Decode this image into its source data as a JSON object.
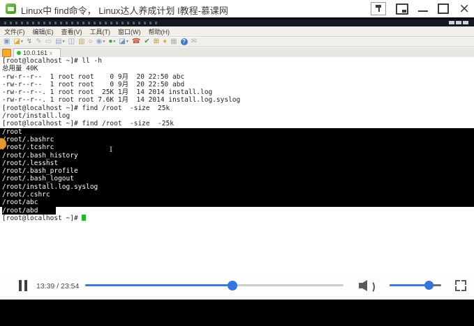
{
  "window": {
    "title": "Linux中 find命令， Linux达人养成计划 I教程-慕课网"
  },
  "crt": {
    "menu": [
      "文件(F)",
      "编辑(E)",
      "查看(V)",
      "工具(T)",
      "窗口(W)",
      "帮助(H)"
    ],
    "tab": {
      "label": "10.0.161",
      "status_color": "#2fbf2f",
      "close_glyph": "x"
    },
    "toolbar_icons": [
      {
        "name": "new-session-icon",
        "glyph": "▣",
        "color": "#7b9cc4",
        "arrow": false
      },
      {
        "name": "quick-connect-icon",
        "glyph": "◪",
        "color": "#d9a43a",
        "arrow": true
      },
      {
        "name": "connect-icon",
        "glyph": "↯",
        "color": "#8d8d86",
        "arrow": false
      },
      {
        "name": "edit-icon",
        "glyph": "✎",
        "color": "#b3b3ab",
        "arrow": false
      },
      {
        "name": "reconnect-icon",
        "glyph": "▭",
        "color": "#b3b3ab",
        "arrow": false
      },
      {
        "name": "print-icon",
        "glyph": "▤",
        "color": "#8fa8c4",
        "arrow": true
      },
      {
        "name": "copy-icon",
        "glyph": "◫",
        "color": "#7b9cc4",
        "arrow": false
      },
      {
        "name": "paste-icon",
        "glyph": "▥",
        "color": "#c2a46a",
        "arrow": false
      },
      {
        "name": "find-icon",
        "glyph": "○",
        "color": "#8d8d86",
        "arrow": false
      },
      {
        "name": "session-options-icon",
        "glyph": "◉",
        "color": "#8fa8c4",
        "arrow": true
      },
      {
        "name": "web-icon",
        "glyph": "●",
        "color": "#3f9e3f",
        "arrow": true
      },
      {
        "name": "transfer-icon",
        "glyph": "◪",
        "color": "#6f94bf",
        "arrow": true
      },
      {
        "name": "disconnect-icon",
        "glyph": "☎",
        "color": "#c0503a",
        "arrow": false
      },
      {
        "name": "ok-icon",
        "glyph": "✔",
        "color": "#3f9e3f",
        "arrow": false
      },
      {
        "name": "tile-sessions-icon",
        "glyph": "⊞",
        "color": "#c08a3a",
        "arrow": false
      },
      {
        "name": "lock-icon",
        "glyph": "●",
        "color": "#d9b43a",
        "arrow": false
      },
      {
        "name": "cascade-icon",
        "glyph": "▦",
        "color": "#b3b3ab",
        "arrow": false
      },
      {
        "name": "help-icon",
        "glyph": "?",
        "color": "#ffffff",
        "bg": "#3a7bd0",
        "arrow": false
      },
      {
        "name": "chat-icon",
        "glyph": "✉",
        "color": "#9ab4d0",
        "arrow": false
      }
    ]
  },
  "terminal": {
    "lines": [
      {
        "text": "[root@localhost ~]# ll -h",
        "sel": "none"
      },
      {
        "text": "总用量 40K",
        "sel": "none"
      },
      {
        "text": "-rw-r--r--  1 root root    0 9月  20 22:50 abc",
        "sel": "none"
      },
      {
        "text": "-rw-r--r--  1 root root    0 9月  20 22:50 abd",
        "sel": "none"
      },
      {
        "text": "-rw-r--r--. 1 root root  25K 1月  14 2014 install.log",
        "sel": "none"
      },
      {
        "text": "-rw-r--r--. 1 root root 7.6K 1月  14 2014 install.log.syslog",
        "sel": "none"
      },
      {
        "text": "[root@localhost ~]# find /root  -size  25k",
        "sel": "none"
      },
      {
        "text": "/root/install.log",
        "sel": "none"
      },
      {
        "text": "[root@localhost ~]# find /root  -size  -25k",
        "sel": "none"
      },
      {
        "text": "/root",
        "sel": "full"
      },
      {
        "text": "/root/.bashrc",
        "sel": "full"
      },
      {
        "text": "/root/.tcshrc",
        "sel": "full"
      },
      {
        "text": "/root/.bash_history",
        "sel": "full"
      },
      {
        "text": "/root/.lesshst",
        "sel": "full"
      },
      {
        "text": "/root/.bash_profile",
        "sel": "full"
      },
      {
        "text": "/root/.bash_logout",
        "sel": "full"
      },
      {
        "text": "/root/install.log.syslog",
        "sel": "full"
      },
      {
        "text": "/root/.cshrc",
        "sel": "full"
      },
      {
        "text": "/root/abc",
        "sel": "full"
      },
      {
        "text": "/root/abd",
        "sel": "text"
      },
      {
        "text": "[root@localhost ~]# ",
        "sel": "none",
        "cursor": true
      }
    ],
    "cursor_color": "#16c222"
  },
  "player": {
    "time_display": "13:39 / 23:54",
    "progress_percent": 57,
    "volume_percent": 75,
    "accent_color": "#3e7cdb"
  }
}
